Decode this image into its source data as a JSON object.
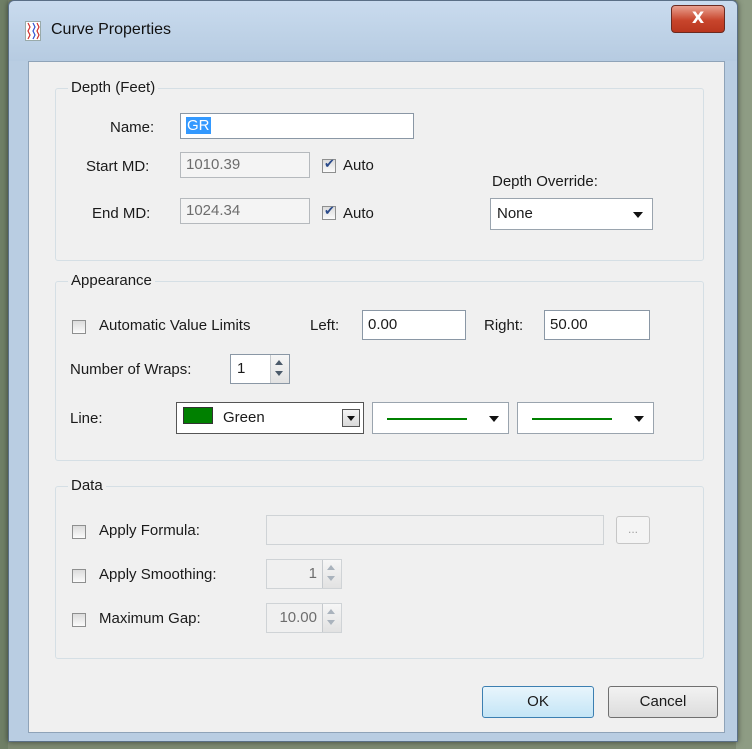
{
  "window": {
    "title": "Curve Properties",
    "close_label": "X"
  },
  "depth": {
    "group_title": "Depth (Feet)",
    "name_label": "Name:",
    "name_value": "GR",
    "start_md_label": "Start MD:",
    "start_md_value": "1010.39",
    "start_auto_label": "Auto",
    "start_auto_checked": true,
    "end_md_label": "End MD:",
    "end_md_value": "1024.34",
    "end_auto_label": "Auto",
    "end_auto_checked": true,
    "override_label": "Depth Override:",
    "override_value": "None"
  },
  "appearance": {
    "group_title": "Appearance",
    "auto_limits_label": "Automatic Value Limits",
    "auto_limits_checked": false,
    "left_label": "Left:",
    "left_value": "0.00",
    "right_label": "Right:",
    "right_value": "50.00",
    "wraps_label": "Number of Wraps:",
    "wraps_value": "1",
    "line_label": "Line:",
    "line_color_name": "Green",
    "line_color_hex": "#008000"
  },
  "data_group": {
    "group_title": "Data",
    "formula_label": "Apply Formula:",
    "formula_checked": false,
    "formula_value": "",
    "browse_label": "...",
    "smoothing_label": "Apply Smoothing:",
    "smoothing_checked": false,
    "smoothing_value": "1",
    "gap_label": "Maximum Gap:",
    "gap_checked": false,
    "gap_value": "10.00"
  },
  "buttons": {
    "ok_label": "OK",
    "cancel_label": "Cancel"
  }
}
